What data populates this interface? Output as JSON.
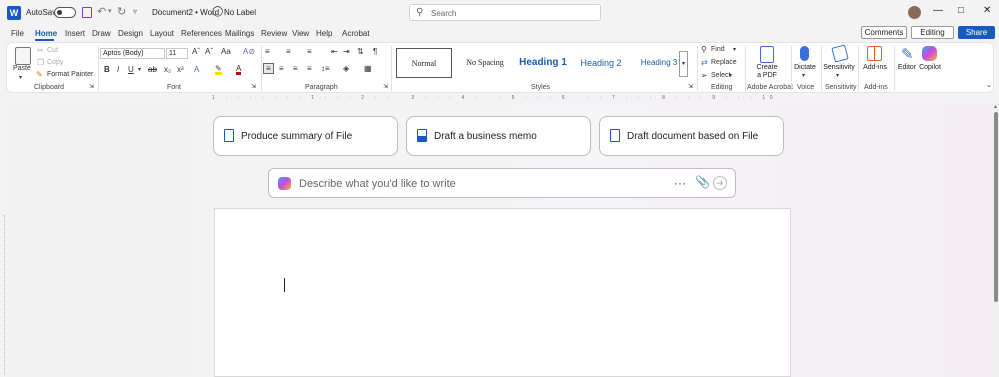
{
  "titlebar": {
    "autosave_label": "AutoSave",
    "autosave_state": "Off",
    "doc_title": "Document2 • Word",
    "sensitivity": "No Label",
    "search_placeholder": "Search"
  },
  "tabs": [
    "File",
    "Home",
    "Insert",
    "Draw",
    "Design",
    "Layout",
    "References",
    "Mailings",
    "Review",
    "View",
    "Help",
    "Acrobat"
  ],
  "active_tab": "Home",
  "right_buttons": {
    "comments": "Comments",
    "editing": "Editing",
    "share": "Share"
  },
  "ribbon": {
    "clipboard": {
      "paste": "Paste",
      "cut": "Cut",
      "copy": "Copy",
      "format_painter": "Format Painter",
      "label": "Clipboard"
    },
    "font": {
      "name": "Aptos (Body)",
      "size": "11",
      "label": "Font"
    },
    "paragraph": {
      "label": "Paragraph"
    },
    "styles": {
      "items": [
        "Normal",
        "No Spacing",
        "Heading 1",
        "Heading 2",
        "Heading 3"
      ],
      "label": "Styles"
    },
    "editing": {
      "find": "Find",
      "replace": "Replace",
      "select": "Select",
      "label": "Editing"
    },
    "acrobat": {
      "create_pdf": "Create\na PDF",
      "label": "Adobe Acrobat"
    },
    "voice": {
      "dictate": "Dictate",
      "label": "Voice"
    },
    "sensitivity": {
      "button": "Sensitivity",
      "label": "Sensitivity"
    },
    "addins": {
      "button": "Add-ins",
      "label": "Add-ins"
    },
    "editor": "Editor",
    "copilot": "Copilot"
  },
  "ruler_text": "1 · · · · · · · 1 · · · 2 · · · 3 · · · 4 · · · 5 · · · 6 · · · 7 · · · 8 · · · 9 · · · 10 · · 11 · · 12 · · 13 · · 14 · · 15 · ·",
  "copilot_cards": [
    {
      "label": "Produce summary of File"
    },
    {
      "label": "Draft a business memo"
    },
    {
      "label": "Draft document based on File"
    }
  ],
  "prompt_placeholder": "Describe what you'd like to write"
}
